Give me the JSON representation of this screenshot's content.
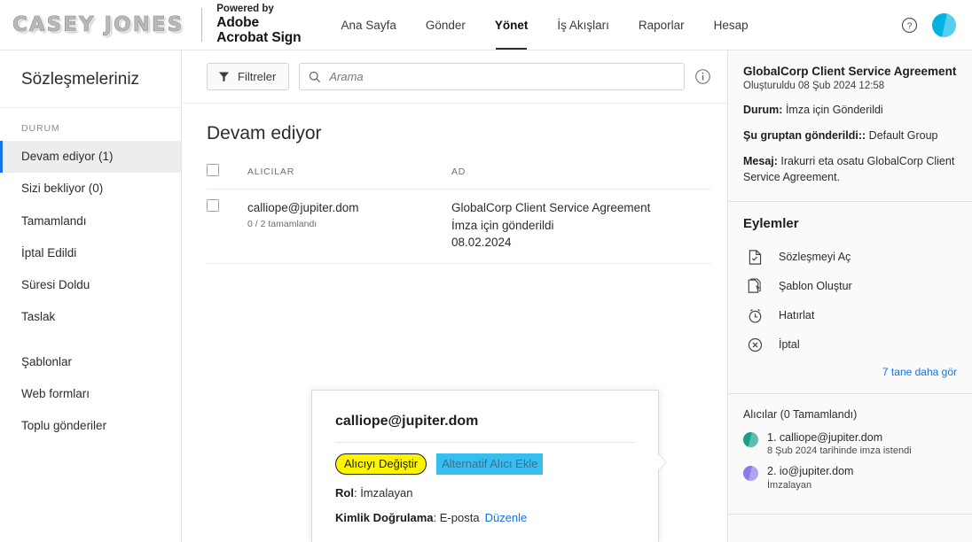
{
  "topbar": {
    "brand_text": "CASEY JONES",
    "powered_by": "Powered by",
    "adobe": "Adobe",
    "acrobat_sign": "Acrobat Sign",
    "nav": [
      {
        "label": "Ana Sayfa",
        "active": false
      },
      {
        "label": "Gönder",
        "active": false
      },
      {
        "label": "Yönet",
        "active": true
      },
      {
        "label": "İş Akışları",
        "active": false
      },
      {
        "label": "Raporlar",
        "active": false
      },
      {
        "label": "Hesap",
        "active": false
      }
    ],
    "help_icon": "question-mark-circle-icon",
    "avatar_icon": "user-avatar",
    "avatar_color": "#00b3e3"
  },
  "sidebar": {
    "title": "Sözleşmeleriniz",
    "section_label": "DURUM",
    "items": [
      {
        "label": "Devam ediyor (1)",
        "active": true
      },
      {
        "label": "Sizi bekliyor (0)",
        "active": false
      },
      {
        "label": "Tamamlandı",
        "active": false
      },
      {
        "label": "İptal Edildi",
        "active": false
      },
      {
        "label": "Süresi Doldu",
        "active": false
      },
      {
        "label": "Taslak",
        "active": false
      }
    ],
    "extra_items": [
      {
        "label": "Şablonlar"
      },
      {
        "label": "Web formları"
      },
      {
        "label": "Toplu gönderiler"
      }
    ],
    "active_accent": "#1473e6"
  },
  "toolbar": {
    "filter_label": "Filtreler",
    "filter_icon": "funnel-icon",
    "search_icon": "search-icon",
    "search_value": "",
    "search_placeholder": "Arama",
    "info_icon": "info-circle-icon"
  },
  "list": {
    "heading": "Devam ediyor",
    "columns": [
      "",
      "ALICILAR",
      "AD"
    ],
    "rows": [
      {
        "recipient": "calliope@jupiter.dom",
        "recipient_sub": "0 / 2 tamamlandı",
        "name_line1": "GlobalCorp Client Service Agreement",
        "name_line2": "İmza için gönderildi",
        "name_line3": "08.02.2024"
      }
    ]
  },
  "details": {
    "title": "GlobalCorp Client Service Agreement",
    "created": "Oluşturuldu 08 Şub 2024 12:58",
    "status_key": "Durum:",
    "status_value": "İmza için Gönderildi",
    "group_key": "Şu gruptan gönderildi::",
    "group_value": "Default Group",
    "message_key": "Mesaj:",
    "message_value": "Irakurri eta osatu GlobalCorp Client Service Agreement."
  },
  "actions": {
    "title": "Eylemler",
    "items": [
      {
        "label": "Sözleşmeyi Aç",
        "icon": "document-check-icon"
      },
      {
        "label": "Şablon Oluştur",
        "icon": "template-cursor-icon"
      },
      {
        "label": "Hatırlat",
        "icon": "alarm-clock-icon"
      },
      {
        "label": "İptal",
        "icon": "circle-x-icon"
      }
    ],
    "see_more": "7 tane daha gör"
  },
  "recipients_panel": {
    "title": "Alıcılar (0 Tamamlandı)",
    "items": [
      {
        "name": "1. calliope@jupiter.dom",
        "sub": "8 Şub 2024 tarihinde imza istendi",
        "color": "#16a085"
      },
      {
        "name": "2. io@jupiter.dom",
        "sub": "İmzalayan",
        "color": "#8c7ae6"
      }
    ]
  },
  "popup": {
    "email": "calliope@jupiter.dom",
    "change_recipient": "Alıcıyı Değiştir",
    "add_alternate": "Alternatif Alıcı Ekle",
    "role_key": "Rol",
    "role_value": "İmzalayan",
    "auth_key": "Kimlik Doğrulama",
    "auth_value": "E-posta",
    "edit_link": "Düzenle",
    "highlight_yellow": "#fcf400",
    "highlight_cyan": "#38bdef"
  }
}
